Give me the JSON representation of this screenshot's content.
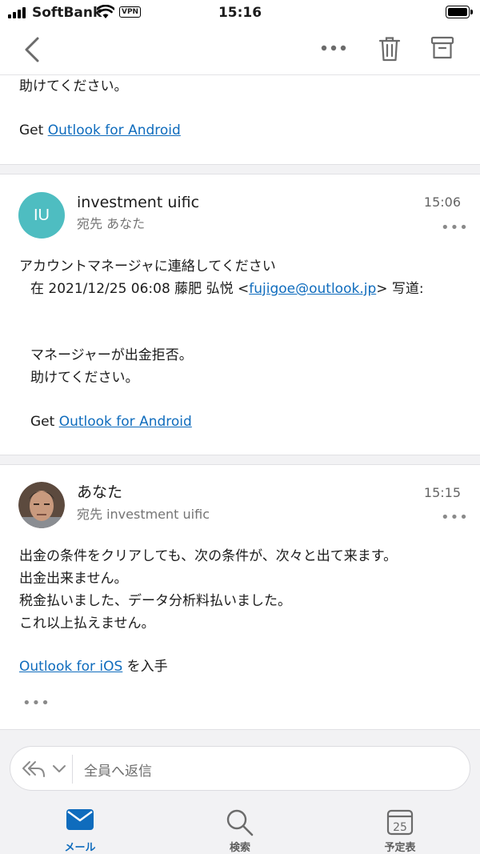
{
  "status": {
    "carrier": "SoftBank",
    "vpn": "VPN",
    "time": "15:16"
  },
  "nav": {
    "back_icon": "chevron-left-icon",
    "more_icon": "ellipsis-icon",
    "delete_icon": "trash-icon",
    "archive_icon": "archive-icon"
  },
  "message1": {
    "line1": "助けてください。",
    "get_prefix": "Get ",
    "get_link": "Outlook for Android"
  },
  "message2": {
    "initials": "IU",
    "sender": "investment uific",
    "to": "宛先 あなた",
    "time": "15:06",
    "more": "•••",
    "body1": "アカウントマネージャに連絡してください",
    "quote_prefix": "在 2021/12/25 06:08 藤肥 弘悦 <",
    "quote_email": "fujigoe@outlook.jp",
    "quote_suffix": "> 写道:",
    "quote_line1": "マネージャーが出金拒否。",
    "quote_line2": "助けてください。",
    "get_prefix": "Get ",
    "get_link": "Outlook for Android"
  },
  "message3": {
    "sender": "あなた",
    "to": "宛先 investment uific",
    "time": "15:15",
    "more": "•••",
    "body1": "出金の条件をクリアしても、次の条件が、次々と出て来ます。",
    "body2": "出金出来ません。",
    "body3": "税金払いました、データ分析料払いました。",
    "body4": "これ以上払えません。",
    "signature_link": "Outlook for iOS",
    "signature_suffix": " を入手",
    "expand": "•••"
  },
  "reply": {
    "reply_all_icon": "reply-all-icon",
    "dropdown_icon": "chevron-down-icon",
    "placeholder": "全員へ返信"
  },
  "tabs": [
    {
      "label": "メール",
      "icon": "mail-icon",
      "active": true
    },
    {
      "label": "検索",
      "icon": "search-icon",
      "active": false
    },
    {
      "label": "予定表",
      "icon": "calendar-icon",
      "active": false,
      "badge": "25"
    }
  ],
  "colors": {
    "accent": "#0f6cbd",
    "avatar_teal": "#4ebdc1"
  }
}
